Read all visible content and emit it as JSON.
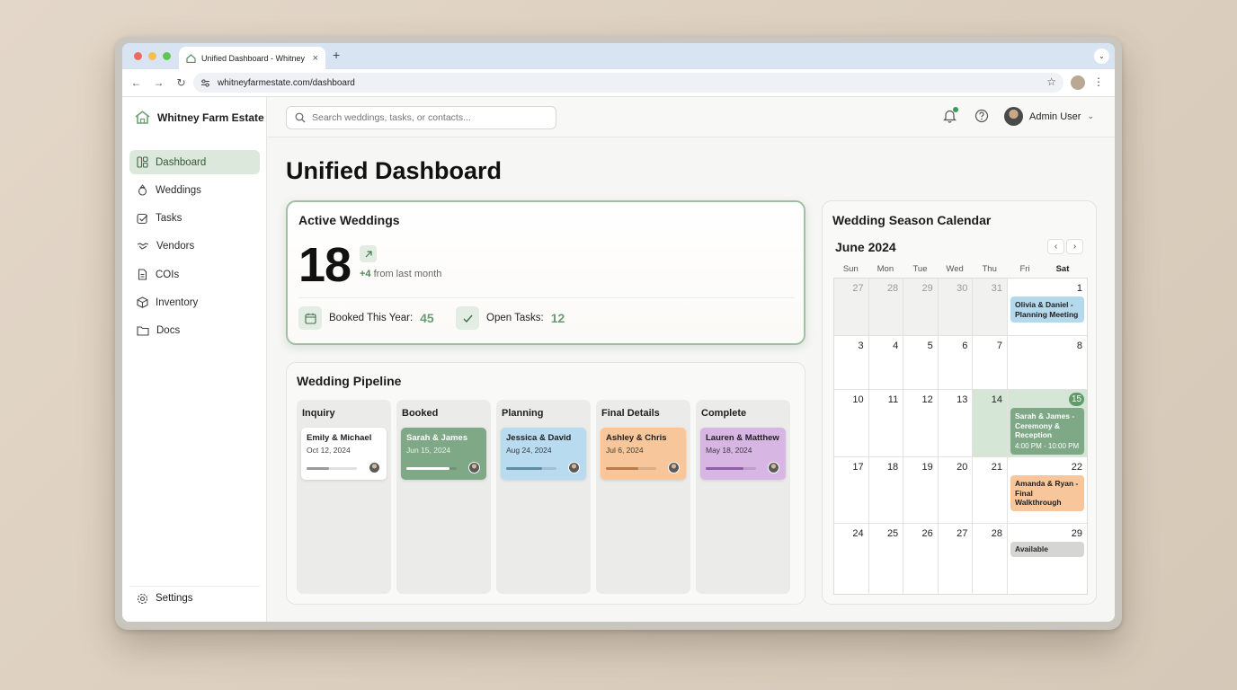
{
  "browser": {
    "tab_title": "Unified Dashboard - Whitney",
    "url": "whitneyfarmestate.com/dashboard"
  },
  "brand": {
    "name": "Whitney Farm Estate"
  },
  "sidebar": {
    "items": [
      {
        "label": "Dashboard",
        "icon": "dashboard-icon",
        "active": true
      },
      {
        "label": "Weddings",
        "icon": "ring-icon"
      },
      {
        "label": "Tasks",
        "icon": "checkbox-icon"
      },
      {
        "label": "Vendors",
        "icon": "handshake-icon"
      },
      {
        "label": "COIs",
        "icon": "document-icon"
      },
      {
        "label": "Inventory",
        "icon": "box-icon"
      },
      {
        "label": "Docs",
        "icon": "folder-icon"
      }
    ],
    "settings": "Settings"
  },
  "topbar": {
    "search_placeholder": "Search weddings, tasks, or contacts...",
    "user_name": "Admin User"
  },
  "page": {
    "title": "Unified Dashboard"
  },
  "active_weddings": {
    "title": "Active Weddings",
    "count": "18",
    "trend_value": "+4",
    "trend_text": " from last month",
    "booked_label": "Booked This Year:",
    "booked_value": "45",
    "tasks_label": "Open Tasks:",
    "tasks_value": "12"
  },
  "pipeline": {
    "title": "Wedding Pipeline",
    "columns": [
      {
        "title": "Inquiry",
        "card": {
          "name": "Emily & Michael",
          "date": "Oct 12, 2024",
          "progress": 0.45,
          "bg": "#ffffff",
          "fg": "#1e1e1e",
          "bar": "#9a9a9a"
        }
      },
      {
        "title": "Booked",
        "card": {
          "name": "Sarah & James",
          "date": "Jun 15, 2024",
          "progress": 0.85,
          "bg": "#7fa886",
          "fg": "#ffffff",
          "bar": "#ffffff"
        }
      },
      {
        "title": "Planning",
        "card": {
          "name": "Jessica & David",
          "date": "Aug 24, 2024",
          "progress": 0.72,
          "bg": "#b9dbef",
          "fg": "#1e1e1e",
          "bar": "#5f8da6"
        }
      },
      {
        "title": "Final Details",
        "card": {
          "name": "Ashley & Chris",
          "date": "Jul 6, 2024",
          "progress": 0.65,
          "bg": "#f7c79b",
          "fg": "#1e1e1e",
          "bar": "#b97b48"
        }
      },
      {
        "title": "Complete",
        "card": {
          "name": "Lauren & Matthew",
          "date": "May 18, 2024",
          "progress": 0.75,
          "bg": "#d7b6e4",
          "fg": "#1e1e1e",
          "bar": "#8e5fa4"
        }
      }
    ]
  },
  "calendar": {
    "title": "Wedding Season Calendar",
    "month": "June 2024",
    "prev": "‹",
    "next": "›",
    "weekdays": [
      "Sun",
      "Mon",
      "Tue",
      "Wed",
      "Thu",
      "Fri",
      "Sat"
    ],
    "weeks": [
      [
        "27",
        "28",
        "29",
        "30",
        "31",
        "",
        "1"
      ],
      [
        "3",
        "4",
        "5",
        "6",
        "7",
        "",
        "8"
      ],
      [
        "10",
        "11",
        "12",
        "13",
        "14",
        "",
        "15"
      ],
      [
        "17",
        "18",
        "19",
        "20",
        "21",
        "",
        "22"
      ],
      [
        "24",
        "25",
        "26",
        "27",
        "28",
        "",
        "29"
      ]
    ],
    "events": [
      {
        "week": 0,
        "title": "Olivia & Daniel - Planning Meeting",
        "time": "",
        "bg": "#b4d9ec",
        "fg": "#1e1e1e"
      },
      {
        "week": 2,
        "title": "Sarah & James - Ceremony & Reception",
        "time": "4:00 PM - 10:00 PM",
        "bg": "#7fa886",
        "fg": "#ffffff"
      },
      {
        "week": 3,
        "title": "Amanda & Ryan - Final Walkthrough",
        "time": "",
        "bg": "#f7c79b",
        "fg": "#1e1e1e"
      },
      {
        "week": 4,
        "title": "Available",
        "time": "",
        "bg": "#d5d5d3",
        "fg": "#2a2a2a"
      }
    ],
    "today": "15"
  },
  "colors": {
    "accent": "#5e9c6a",
    "active_nav": "#dde8dc",
    "card_border": "#9fc0a3"
  }
}
